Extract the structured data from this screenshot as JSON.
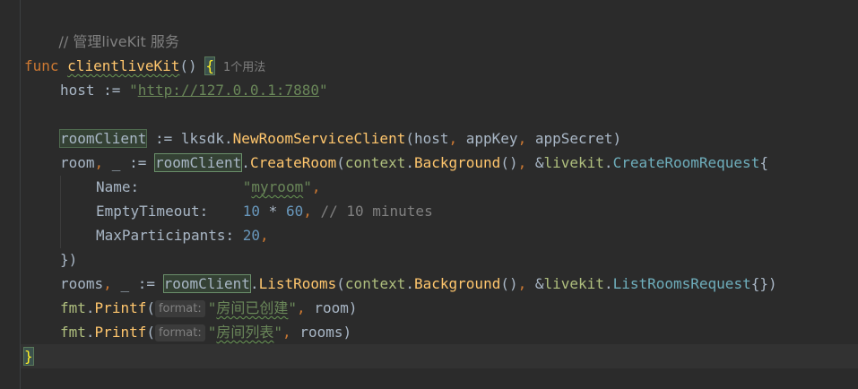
{
  "comment": "// 管理liveKit 服务",
  "func_keyword": "func",
  "func_name": "clientliveKit",
  "func_sig_rest": "() ",
  "open_brace": "{",
  "usage_hint": "1个用法",
  "host_var": "host",
  "assign": " := ",
  "quote": "\"",
  "host_url": "http://127.0.0.1:7880",
  "room_client_var": "roomClient",
  "lksdk_pkg": "lksdk",
  "dot": ".",
  "new_client_fn": "NewRoomServiceClient",
  "new_client_args_open": "(",
  "arg_host": "host",
  "comma_sep": ", ",
  "arg_appkey": "appKey",
  "arg_appsecret": "appSecret",
  "close_paren": ")",
  "room_var": "room",
  "blank_var": "_",
  "create_room_fn": "CreateRoom",
  "context_pkg": "context",
  "background_fn": "Background",
  "call_parens": "()",
  "amp": "&",
  "livekit_pkg": "livekit",
  "create_room_req": "CreateRoomRequest",
  "brace_open": "{",
  "field_name": "Name",
  "field_name_colon": ":",
  "name_pad": "            ",
  "room_name": "myroom",
  "trailing_comma": ",",
  "field_empty_timeout": "EmptyTimeout",
  "timeout_pad": "    ",
  "timeout_a": "10",
  "mul": " * ",
  "timeout_b": "60",
  "timeout_comment": "// 10 minutes",
  "field_max_participants": "MaxParticipants",
  "max_participants": "20",
  "close_struct": "})",
  "rooms_var": "rooms",
  "list_rooms_fn": "ListRooms",
  "list_rooms_req": "ListRoomsRequest",
  "empty_struct_close": "{})",
  "fmt_pkg": "fmt",
  "printf_fn": "Printf",
  "inlay_format": "format:",
  "msg_created": "房间已创建",
  "msg_list": "房间列表",
  "arg_room": "room",
  "arg_rooms": "rooms",
  "close_brace": "}"
}
